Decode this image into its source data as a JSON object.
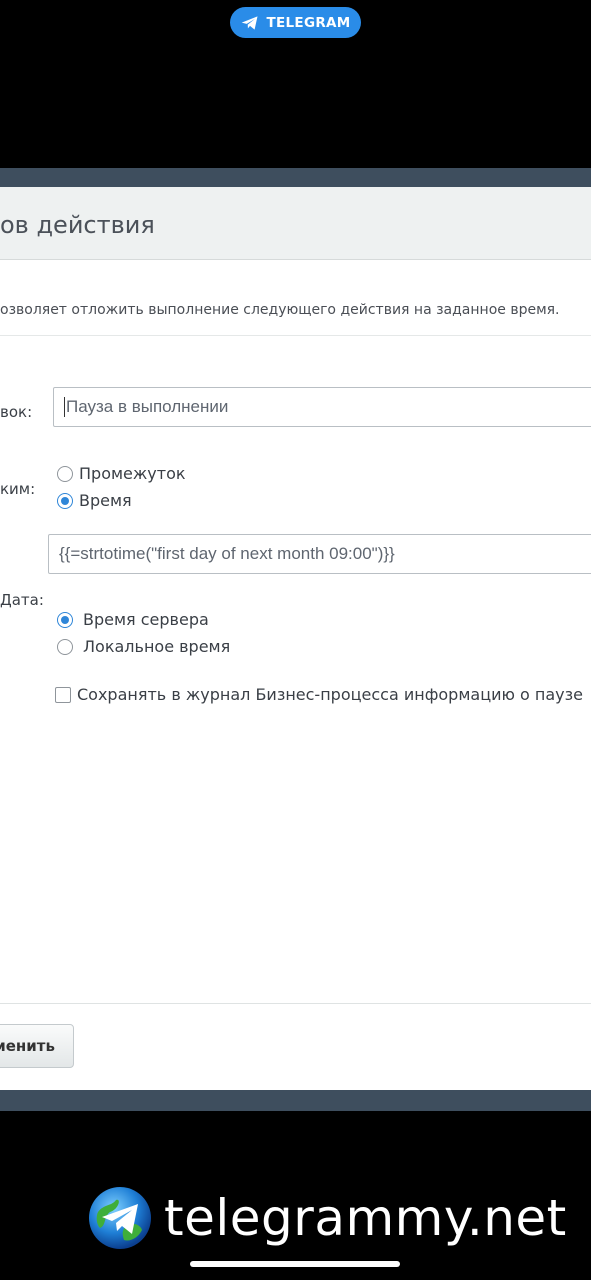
{
  "overlay": {
    "telegram_pill": "TELEGRAM",
    "watermark": "telegrammy.net"
  },
  "dialog": {
    "title": "ов действия",
    "description": "озволяет отложить выполнение следующего действия на заданное время.",
    "fields": {
      "title_label": "вок:",
      "title_value": "Пауза в выполнении",
      "mode_label": "ким:",
      "mode_options": [
        {
          "label": "Промежуток",
          "checked": false
        },
        {
          "label": "Время",
          "checked": true
        }
      ],
      "time_value": "{{=strtotime(\"first day of next month 09:00\")}}",
      "date_label": "Дата:",
      "date_options": [
        {
          "label": "Время сервера",
          "checked": true
        },
        {
          "label": "Локальное время",
          "checked": false
        }
      ],
      "log_checkbox_label": "Сохранять в журнал Бизнес-процесса информацию о паузе",
      "log_checked": false
    },
    "apply_label": "менить"
  },
  "colors": {
    "accent": "#2f86d8",
    "telegram": "#2a8ce8"
  }
}
